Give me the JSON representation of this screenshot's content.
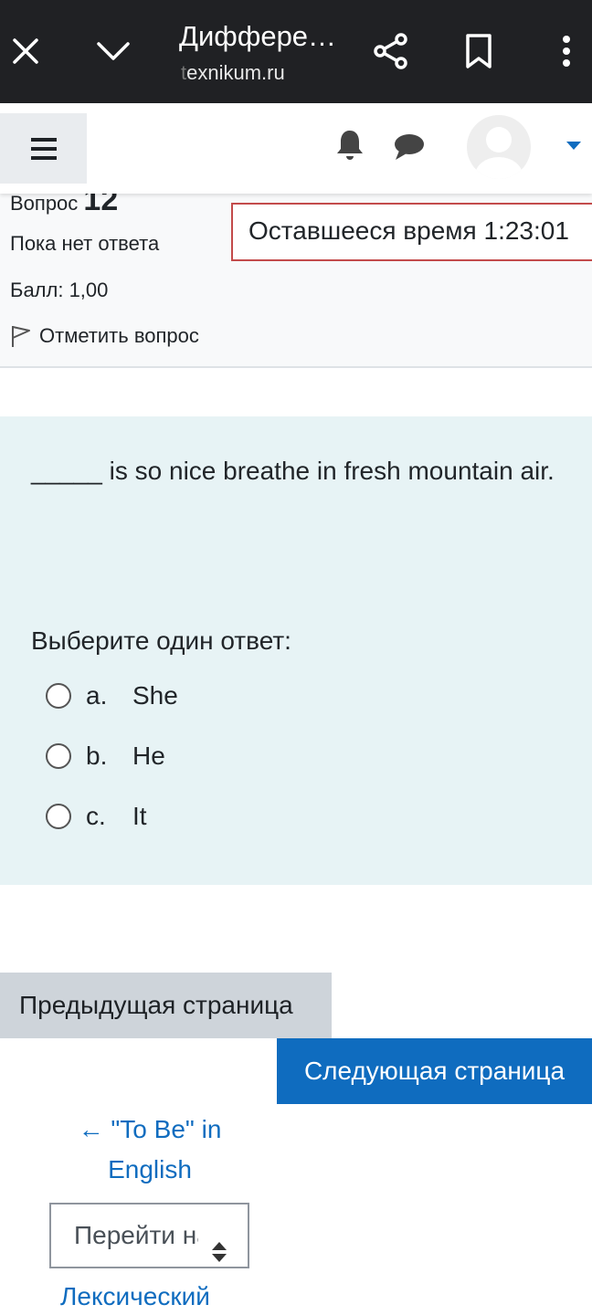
{
  "browser": {
    "title": "Диффере…",
    "url_faded": "t",
    "url_rest": "exnikum.ru",
    "icons": [
      "close-icon",
      "chevron-down-icon",
      "share-icon",
      "bookmark-icon",
      "more-vert-icon"
    ]
  },
  "nav": {
    "icons": [
      "hamburger-icon",
      "bell-icon",
      "chat-icon",
      "avatar",
      "caret-down-icon"
    ],
    "accent_color": "#0f6cbf"
  },
  "question_info": {
    "label": "Вопрос",
    "number": "12",
    "state": "Пока нет ответа",
    "grade": "Балл: 1,00",
    "flag_label": "Отметить вопрос"
  },
  "timer": {
    "text": "Оставшееся время 1:23:01",
    "border_color": "#c34b4b"
  },
  "question": {
    "text": "_____ is so nice breathe in fresh mountain air.",
    "prompt": "Выберите один ответ:",
    "answers": [
      {
        "letter": "a.",
        "text": "She"
      },
      {
        "letter": "b.",
        "text": "He"
      },
      {
        "letter": "c.",
        "text": "It"
      }
    ]
  },
  "buttons": {
    "prev": "Предыдущая страница",
    "next": "Следующая страница"
  },
  "activity_nav": {
    "prev_link": "← \"To Be\" in English",
    "jump_select": "Перейти на...",
    "next_link": "Лексический"
  }
}
